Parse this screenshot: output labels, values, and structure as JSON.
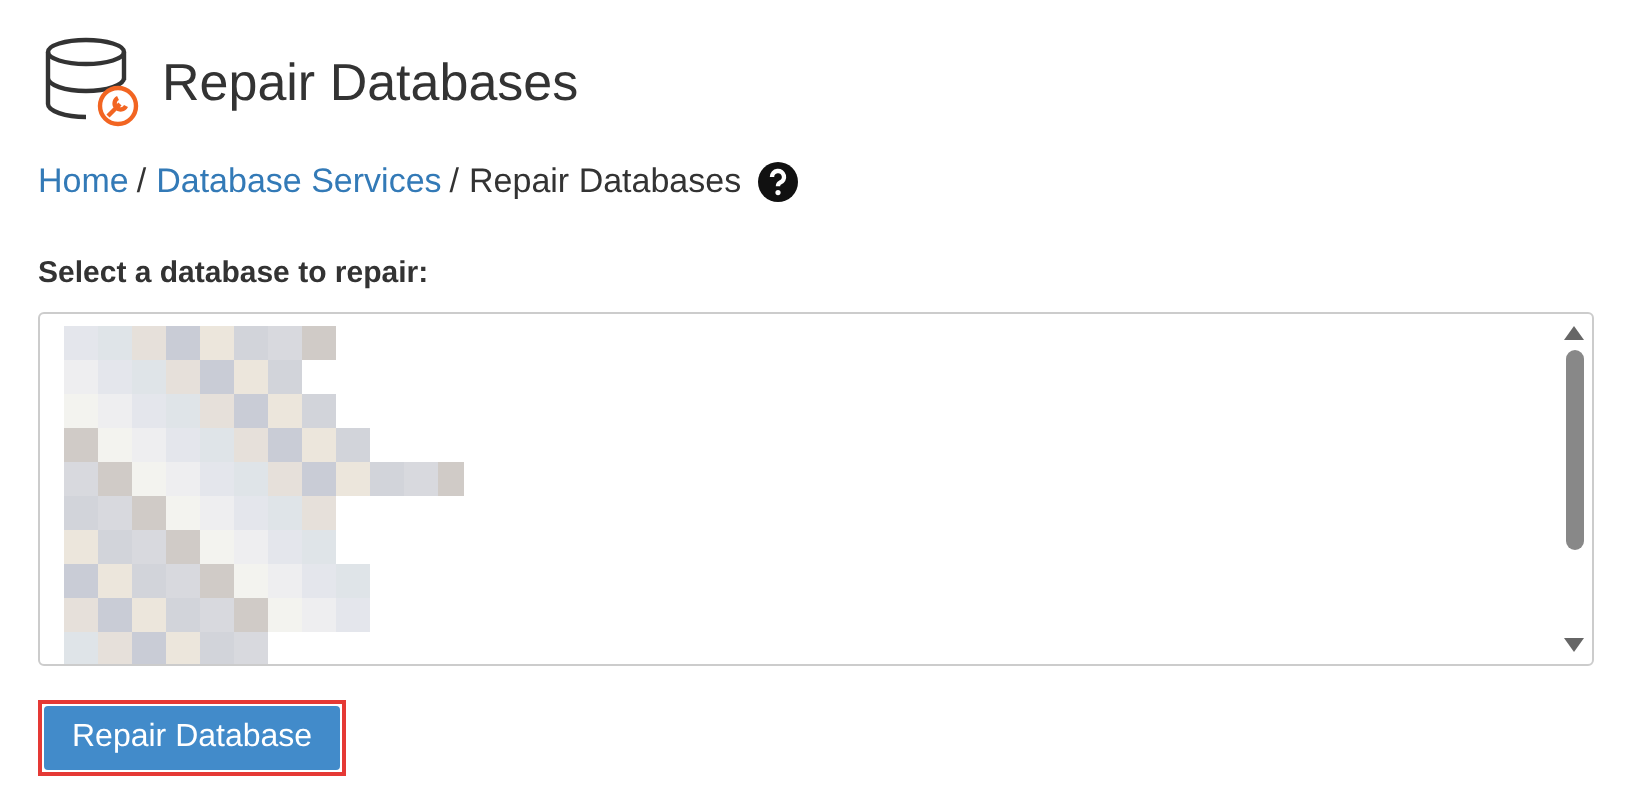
{
  "header": {
    "title": "Repair Databases"
  },
  "breadcrumb": [
    {
      "label": "Home",
      "kind": "link"
    },
    {
      "label": "/",
      "kind": "separator"
    },
    {
      "label": "Database Services",
      "kind": "link"
    },
    {
      "label": "/",
      "kind": "separator"
    },
    {
      "label": "Repair Databases",
      "kind": "current"
    }
  ],
  "form": {
    "label": "Select a database to repair:",
    "button": "Repair Database"
  }
}
